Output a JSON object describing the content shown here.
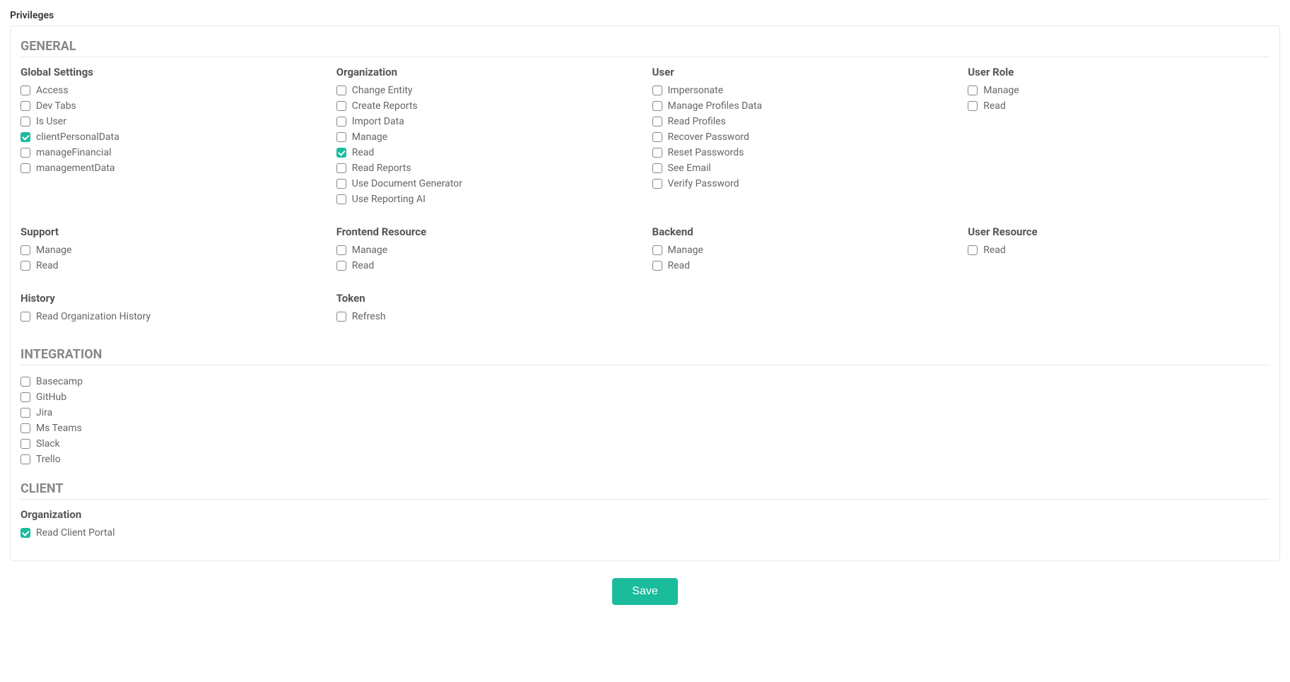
{
  "page_title": "Privileges",
  "save_button": "Save",
  "sections": {
    "general": {
      "heading": "GENERAL",
      "rows": [
        {
          "global_settings": {
            "title": "Global Settings",
            "items": [
              {
                "label": "Access",
                "checked": false
              },
              {
                "label": "Dev Tabs",
                "checked": false
              },
              {
                "label": "Is User",
                "checked": false
              },
              {
                "label": "clientPersonalData",
                "checked": true
              },
              {
                "label": "manageFinancial",
                "checked": false
              },
              {
                "label": "managementData",
                "checked": false
              }
            ]
          },
          "organization": {
            "title": "Organization",
            "items": [
              {
                "label": "Change Entity",
                "checked": false
              },
              {
                "label": "Create Reports",
                "checked": false
              },
              {
                "label": "Import Data",
                "checked": false
              },
              {
                "label": "Manage",
                "checked": false
              },
              {
                "label": "Read",
                "checked": true
              },
              {
                "label": "Read Reports",
                "checked": false
              },
              {
                "label": "Use Document Generator",
                "checked": false
              },
              {
                "label": "Use Reporting AI",
                "checked": false
              }
            ]
          },
          "user": {
            "title": "User",
            "items": [
              {
                "label": "Impersonate",
                "checked": false
              },
              {
                "label": "Manage Profiles Data",
                "checked": false
              },
              {
                "label": "Read Profiles",
                "checked": false
              },
              {
                "label": "Recover Password",
                "checked": false
              },
              {
                "label": "Reset Passwords",
                "checked": false
              },
              {
                "label": "See Email",
                "checked": false
              },
              {
                "label": "Verify Password",
                "checked": false
              }
            ]
          },
          "user_role": {
            "title": "User Role",
            "items": [
              {
                "label": "Manage",
                "checked": false
              },
              {
                "label": "Read",
                "checked": false
              }
            ]
          }
        },
        {
          "support": {
            "title": "Support",
            "items": [
              {
                "label": "Manage",
                "checked": false
              },
              {
                "label": "Read",
                "checked": false
              }
            ]
          },
          "frontend_resource": {
            "title": "Frontend Resource",
            "items": [
              {
                "label": "Manage",
                "checked": false
              },
              {
                "label": "Read",
                "checked": false
              }
            ]
          },
          "backend": {
            "title": "Backend",
            "items": [
              {
                "label": "Manage",
                "checked": false
              },
              {
                "label": "Read",
                "checked": false
              }
            ]
          },
          "user_resource": {
            "title": "User Resource",
            "items": [
              {
                "label": "Read",
                "checked": false
              }
            ]
          }
        },
        {
          "history": {
            "title": "History",
            "items": [
              {
                "label": "Read Organization History",
                "checked": false
              }
            ]
          },
          "token": {
            "title": "Token",
            "items": [
              {
                "label": "Refresh",
                "checked": false
              }
            ]
          }
        }
      ]
    },
    "integration": {
      "heading": "INTEGRATION",
      "items": [
        {
          "label": "Basecamp",
          "checked": false
        },
        {
          "label": "GitHub",
          "checked": false
        },
        {
          "label": "Jira",
          "checked": false
        },
        {
          "label": "Ms Teams",
          "checked": false
        },
        {
          "label": "Slack",
          "checked": false
        },
        {
          "label": "Trello",
          "checked": false
        }
      ]
    },
    "client": {
      "heading": "CLIENT",
      "organization": {
        "title": "Organization",
        "items": [
          {
            "label": "Read Client Portal",
            "checked": true
          }
        ]
      }
    }
  }
}
